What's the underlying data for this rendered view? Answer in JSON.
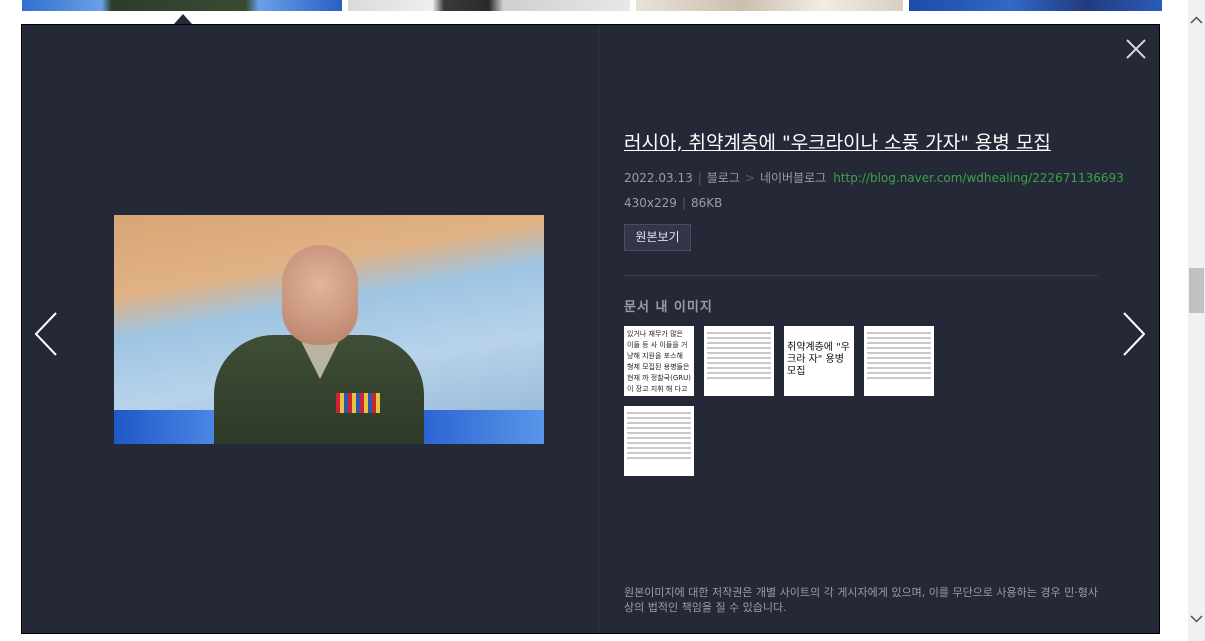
{
  "viewer": {
    "title": "러시아, 취약계층에 \"우크라이나 소풍 가자\" 용병 모집",
    "date": "2022.03.13",
    "source_category": "블로그",
    "source_service": "네이버블로그",
    "source_url": "http://blog.naver.com/wdhealing/222671136693",
    "dimensions": "430x229",
    "file_size": "86KB",
    "original_button_label": "원본보기",
    "section_title": "문서 내 이미지",
    "doc_thumbs": [
      {
        "text": "있거나 재무가 많은 이들 등 사 이들을 거냥해 지원을 포스해 형제 모집된 용병들은 현재 까 정찰국(GRU)이 장고 지휘 해 다고도 덧붙였다"
      },
      {
        "text": ""
      },
      {
        "text": "취약계층에 \"우크라 자\" 용병 모집"
      },
      {
        "text": ""
      },
      {
        "text": ""
      }
    ],
    "copyright": "원본이미지에 대한 저작권은 개별 사이트의 각 게시자에게 있으며, 이를 무단으로 사용하는 경우 민·형사상의 법적인 책임을 질 수 있습니다."
  },
  "icons": {
    "close": "close-icon",
    "prev": "chevron-left-icon",
    "next": "chevron-right-icon",
    "scroll_up": "chevron-up-icon",
    "scroll_down": "chevron-down-icon"
  },
  "colors": {
    "viewer_bg": "#252836",
    "url_green": "#3aa34a",
    "meta_gray": "#9a9da8"
  }
}
